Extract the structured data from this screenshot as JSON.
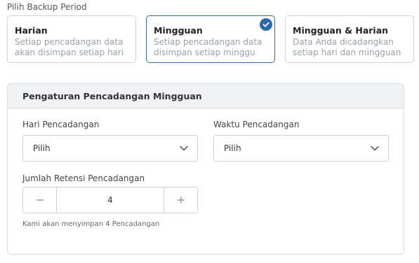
{
  "backup_period": {
    "label": "Pilih Backup Period",
    "options": [
      {
        "title": "Harian",
        "desc_line1": "Setiap pencadangan data",
        "desc_line2": "akan disimpan setiap hari",
        "selected": false
      },
      {
        "title": "Mingguan",
        "desc_line1": "Setiap pencadangan data",
        "desc_line2": "disimpan setiap minggu",
        "selected": true
      },
      {
        "title": "Mingguan & Harian",
        "desc_line1": "Data Anda dicadangkan",
        "desc_line2": "setiap hari dan mingguan",
        "selected": false
      }
    ]
  },
  "weekly_settings": {
    "header": "Pengaturan Pencadangan Mingguan",
    "day": {
      "label": "Hari Pencadangan",
      "value": "Pilih"
    },
    "time": {
      "label": "Waktu Pencadangan",
      "value": "Pilih"
    },
    "retention": {
      "label": "Jumlah Retensi Pencadangan",
      "value": "4",
      "hint": "Kami akan menyimpan 4 Pencadangan"
    }
  },
  "colors": {
    "accent": "#2a6bb0",
    "header_bg": "#f0f2f5",
    "border": "#cfd3d8"
  },
  "icons": {
    "selected": "check-circle-icon",
    "dropdown": "chevron-down-icon",
    "decrement": "minus-icon",
    "increment": "plus-icon"
  }
}
